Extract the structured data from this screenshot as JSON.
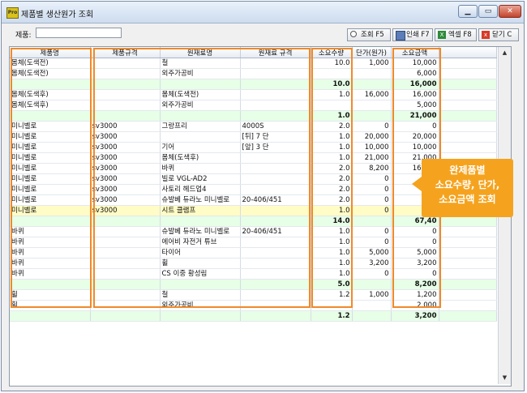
{
  "window": {
    "title": "제품별 생산원가 조회",
    "app_icon": "Pro",
    "min_icon": "▁",
    "max_icon": "▭",
    "close_icon": "✕"
  },
  "filter": {
    "label": "제품:",
    "value": "",
    "placeholder": ""
  },
  "toolbar": {
    "search_label": "조회 F5",
    "print_label": "인쇄 F7",
    "excel_label": "엑셀 F8",
    "close_label": "닫기 C",
    "excel_glyph": "X",
    "close_glyph": "x"
  },
  "columns": [
    "제품명",
    "제품규격",
    "원재료명",
    "원재료 규격",
    "소요수량",
    "단가(원가)",
    "소요금액"
  ],
  "rows": [
    {
      "type": "data",
      "cells": [
        "몸체(도색전)",
        "",
        "철",
        "",
        "10.0",
        "1,000",
        "10,000"
      ]
    },
    {
      "type": "data",
      "cells": [
        "몸체(도색전)",
        "",
        "외주가공비",
        "",
        "",
        "",
        "6,000"
      ]
    },
    {
      "type": "sum",
      "cells": [
        "",
        "",
        "",
        "",
        "10.0",
        "",
        "16,000"
      ]
    },
    {
      "type": "data",
      "cells": [
        "몸체(도색후)",
        "",
        "몸체(도색전)",
        "",
        "1.0",
        "16,000",
        "16,000"
      ]
    },
    {
      "type": "data",
      "cells": [
        "몸체(도색후)",
        "",
        "외주가공비",
        "",
        "",
        "",
        "5,000"
      ]
    },
    {
      "type": "sum",
      "cells": [
        "",
        "",
        "",
        "",
        "1.0",
        "",
        "21,000"
      ]
    },
    {
      "type": "data",
      "cells": [
        "미니벨로",
        "sv3000",
        "그랑프리",
        "4000S",
        "2.0",
        "0",
        "0"
      ]
    },
    {
      "type": "data",
      "cells": [
        "미니벨로",
        "sv3000",
        "",
        "[뒤] 7 단",
        "1.0",
        "20,000",
        "20,000"
      ]
    },
    {
      "type": "data",
      "cells": [
        "미니벨로",
        "sv3000",
        "기어",
        "[앞] 3 단",
        "1.0",
        "10,000",
        "10,000"
      ]
    },
    {
      "type": "data",
      "cells": [
        "미니벨로",
        "sv3000",
        "몸체(도색후)",
        "",
        "1.0",
        "21,000",
        "21,000"
      ]
    },
    {
      "type": "data",
      "cells": [
        "미니벨로",
        "sv3000",
        "바퀴",
        "",
        "2.0",
        "8,200",
        "16,400"
      ]
    },
    {
      "type": "data",
      "cells": [
        "미니벨로",
        "sv3000",
        "빌로 VGL-AD2",
        "",
        "2.0",
        "0",
        ""
      ]
    },
    {
      "type": "data",
      "cells": [
        "미니벨로",
        "sv3000",
        "사토리 헤드업4",
        "",
        "2.0",
        "0",
        ""
      ]
    },
    {
      "type": "data",
      "cells": [
        "미니벨로",
        "sv3000",
        "슈발베 듀라노 미니벨로",
        "20-406/451",
        "2.0",
        "0",
        ""
      ]
    },
    {
      "type": "selected",
      "cells": [
        "미니벨로",
        "sv3000",
        "시트 클램프",
        "",
        "1.0",
        "0",
        ""
      ]
    },
    {
      "type": "sum",
      "cells": [
        "",
        "",
        "",
        "",
        "14.0",
        "",
        "67,40"
      ]
    },
    {
      "type": "data",
      "cells": [
        "바퀴",
        "",
        "슈발베 듀라노 미니벨로",
        "20-406/451",
        "1.0",
        "0",
        "0"
      ]
    },
    {
      "type": "data",
      "cells": [
        "바퀴",
        "",
        "에어비 자전거 튜브",
        "",
        "1.0",
        "0",
        "0"
      ]
    },
    {
      "type": "data",
      "cells": [
        "바퀴",
        "",
        "타이어",
        "",
        "1.0",
        "5,000",
        "5,000"
      ]
    },
    {
      "type": "data",
      "cells": [
        "바퀴",
        "",
        "휠",
        "",
        "1.0",
        "3,200",
        "3,200"
      ]
    },
    {
      "type": "data",
      "cells": [
        "바퀴",
        "",
        "CS 이중 황성림",
        "",
        "1.0",
        "0",
        "0"
      ]
    },
    {
      "type": "sum",
      "cells": [
        "",
        "",
        "",
        "",
        "5.0",
        "",
        "8,200"
      ]
    },
    {
      "type": "data",
      "cells": [
        "휠",
        "",
        "철",
        "",
        "1.2",
        "1,000",
        "1,200"
      ]
    },
    {
      "type": "data",
      "cells": [
        "휠",
        "",
        "외주가공비",
        "",
        "",
        "",
        "2,000"
      ]
    },
    {
      "type": "sum",
      "cells": [
        "",
        "",
        "",
        "",
        "1.2",
        "",
        "3,200"
      ]
    }
  ],
  "scrollbar": {
    "up_icon": "▲",
    "down_icon": "▼"
  },
  "callout": {
    "lines": [
      "완제품별",
      "소요수량, 단가,",
      "소요금액 조회"
    ]
  },
  "colors": {
    "highlight": "#ef8a2a",
    "callout": "#f5a31e",
    "sum_row": "#e6ffe6",
    "selected_row": "#fffcc6"
  }
}
